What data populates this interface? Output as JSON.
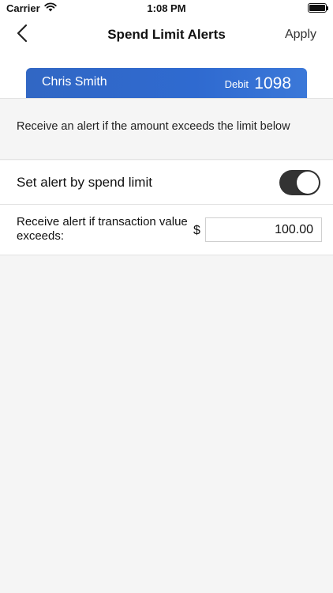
{
  "status_bar": {
    "carrier": "Carrier",
    "time": "1:08 PM"
  },
  "nav": {
    "title": "Spend Limit Alerts",
    "apply_label": "Apply",
    "back_icon": "chevron-left-icon"
  },
  "card": {
    "holder_name": "Chris Smith",
    "type": "Debit",
    "last_four": "1098",
    "color": "#2f6ad0"
  },
  "description": "Receive an alert if the amount exceeds the limit below",
  "toggle_row": {
    "label": "Set alert by spend limit",
    "enabled": true
  },
  "amount_row": {
    "label": "Receive alert if transaction value exceeds:",
    "currency": "$",
    "value": "100.00"
  }
}
